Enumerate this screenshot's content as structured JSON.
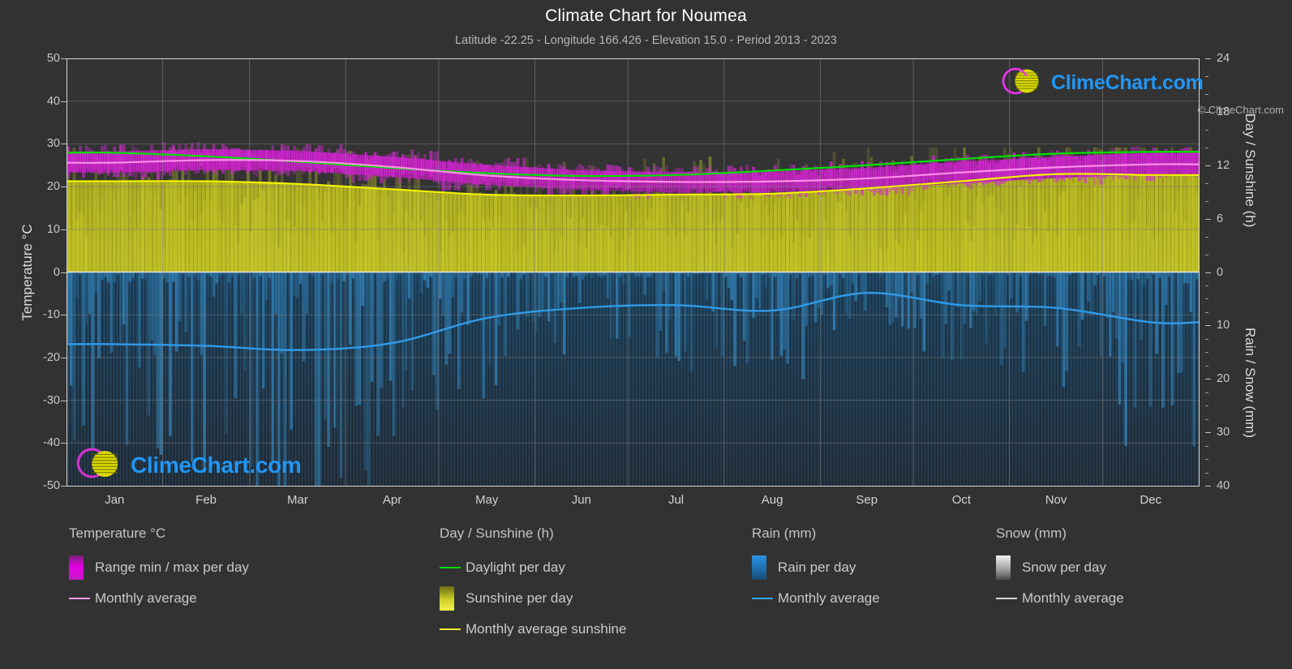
{
  "header": {
    "title": "Climate Chart for Noumea",
    "subtitle": "Latitude -22.25 - Longitude 166.426 - Elevation 15.0 - Period 2013 - 2023"
  },
  "branding": {
    "logo_text": "ClimeChart.com",
    "copyright": "© ClimeChart.com"
  },
  "axes": {
    "left_title": "Temperature °C",
    "right_top_title": "Day / Sunshine (h)",
    "right_bottom_title": "Rain / Snow (mm)",
    "left_ticks": [
      "50",
      "40",
      "30",
      "20",
      "10",
      "0",
      "-10",
      "-20",
      "-30",
      "-40",
      "-50"
    ],
    "right_top_ticks": [
      "24",
      "18",
      "12",
      "6",
      "0"
    ],
    "right_bottom_ticks": [
      "0",
      "10",
      "20",
      "30",
      "40"
    ],
    "x_ticks": [
      "Jan",
      "Feb",
      "Mar",
      "Apr",
      "May",
      "Jun",
      "Jul",
      "Aug",
      "Sep",
      "Oct",
      "Nov",
      "Dec"
    ]
  },
  "legend": {
    "groups": [
      {
        "title": "Temperature °C",
        "items": [
          {
            "label": "Range min / max per day",
            "marker": "swatch",
            "color": "#e100e1"
          },
          {
            "label": "Monthly average",
            "marker": "line",
            "color": "#ff99ee"
          }
        ]
      },
      {
        "title": "Day / Sunshine (h)",
        "items": [
          {
            "label": "Daylight per day",
            "marker": "line",
            "color": "#00dd00"
          },
          {
            "label": "Sunshine per day",
            "marker": "swatch",
            "color": "#eeee33"
          },
          {
            "label": "Monthly average sunshine",
            "marker": "line",
            "color": "#eeee33"
          }
        ]
      },
      {
        "title": "Rain (mm)",
        "items": [
          {
            "label": "Rain per day",
            "marker": "swatch",
            "color": "#1e8ae0"
          },
          {
            "label": "Monthly average",
            "marker": "line",
            "color": "#37a6ee"
          }
        ]
      },
      {
        "title": "Snow (mm)",
        "items": [
          {
            "label": "Snow per day",
            "marker": "swatch",
            "color": "#e8e8e8"
          },
          {
            "label": "Monthly average",
            "marker": "line",
            "color": "#d8d8d8"
          }
        ]
      }
    ]
  },
  "colors": {
    "background": "#323232",
    "plot_background": "#333333",
    "grid": "#6e6e6e",
    "axis": "#d8d8d8",
    "temp_range": "#c020c0",
    "temp_avg": "#ff8fe8",
    "daylight": "#00e000",
    "sunshine_band": "#b5b520",
    "sunshine_avg": "#f2f200",
    "rain_band": "#1f6fa8",
    "rain_avg": "#2f9ae8",
    "brand_blue": "#2196f3",
    "brand_magenta": "#cc33cc",
    "brand_yellow": "#d4d400"
  },
  "chart_data": {
    "type": "area",
    "title": "Climate Chart for Noumea",
    "subtitle": "Latitude -22.25 - Longitude 166.426 - Elevation 15.0 - Period 2013 - 2023",
    "xlabel": "",
    "ylabel": "Temperature °C",
    "ylim": [
      -50,
      50
    ],
    "y2lim_top_hours": [
      0,
      24
    ],
    "y2lim_bottom_mm": [
      0,
      40
    ],
    "grid": true,
    "legend_position": "below",
    "categories": [
      "Jan",
      "Feb",
      "Mar",
      "Apr",
      "May",
      "Jun",
      "Jul",
      "Aug",
      "Sep",
      "Oct",
      "Nov",
      "Dec"
    ],
    "series": [
      {
        "name": "Monthly average temperature (°C)",
        "unit": "°C",
        "color": "#ff8fe8",
        "values": [
          25.6,
          26.2,
          26.0,
          24.6,
          22.6,
          21.5,
          21.1,
          21.2,
          21.9,
          23.3,
          24.5,
          25.2
        ]
      },
      {
        "name": "Daily max temperature (°C)",
        "unit": "°C",
        "color": "#c020c0",
        "values": [
          28.2,
          28.8,
          28.4,
          27.0,
          25.1,
          23.8,
          23.4,
          23.5,
          24.4,
          25.8,
          27.0,
          27.9
        ]
      },
      {
        "name": "Daily min temperature (°C)",
        "unit": "°C",
        "color": "#c020c0",
        "values": [
          23.3,
          23.9,
          23.7,
          22.3,
          20.4,
          19.2,
          18.6,
          18.7,
          19.4,
          20.8,
          22.0,
          22.9
        ]
      },
      {
        "name": "Daylight per day (h)",
        "unit": "h",
        "color": "#00e000",
        "values": [
          13.4,
          13.0,
          12.4,
          11.7,
          11.1,
          10.8,
          10.9,
          11.4,
          12.0,
          12.7,
          13.3,
          13.5
        ]
      },
      {
        "name": "Monthly average sunshine (h)",
        "unit": "h",
        "color": "#f2f200",
        "values": [
          10.2,
          10.2,
          9.9,
          9.3,
          8.7,
          8.6,
          8.7,
          8.8,
          9.4,
          10.2,
          11.0,
          10.9
        ]
      },
      {
        "name": "Monthly average rain (mm)",
        "unit": "mm",
        "color": "#2f9ae8",
        "values": [
          13.5,
          13.8,
          14.6,
          13.3,
          8.6,
          6.7,
          6.2,
          7.2,
          3.9,
          6.2,
          6.7,
          9.4
        ]
      },
      {
        "name": "Monthly average snow (mm)",
        "unit": "mm",
        "color": "#d8d8d8",
        "values": [
          0,
          0,
          0,
          0,
          0,
          0,
          0,
          0,
          0,
          0,
          0,
          0
        ]
      }
    ]
  }
}
